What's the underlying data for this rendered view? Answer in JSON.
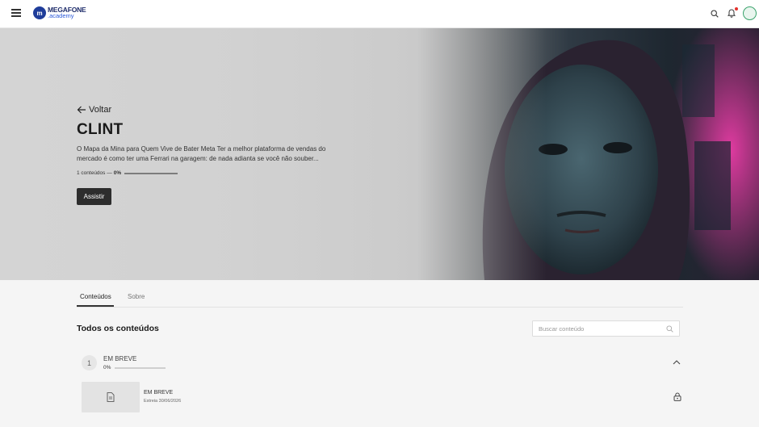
{
  "header": {
    "logo_line1": "MEGAFONE",
    "logo_line2": ".academy",
    "logo_mark": "m",
    "menu_icon": "hamburger-icon",
    "search_icon": "search-icon",
    "bell_icon": "bell-icon",
    "brand_color": "#1f3d9a"
  },
  "hero": {
    "back_label": "Voltar",
    "title": "CLINT",
    "description": "O Mapa da Mina para Quem Vive de Bater Meta Ter a melhor plataforma de vendas do mercado é como ter uma Ferrari na garagem: de nada adianta se você não souber...",
    "contents_count": "1 conteúdos —",
    "progress_label": "0%",
    "progress_value": 0,
    "watch_label": "Assistir"
  },
  "tabs": [
    {
      "label": "Conteúdos",
      "active": true
    },
    {
      "label": "Sobre",
      "active": false
    }
  ],
  "contents": {
    "section_title": "Todos os conteúdos",
    "search_placeholder": "Buscar conteúdo",
    "module": {
      "number": "1",
      "title": "EM BREVE",
      "progress_label": "0%",
      "progress_value": 0,
      "lessons": [
        {
          "title": "EM BREVE",
          "subtitle": "Estreia 30/06/2026",
          "thumb_icon": "document-icon",
          "status_icon": "lock-icon"
        }
      ]
    }
  }
}
